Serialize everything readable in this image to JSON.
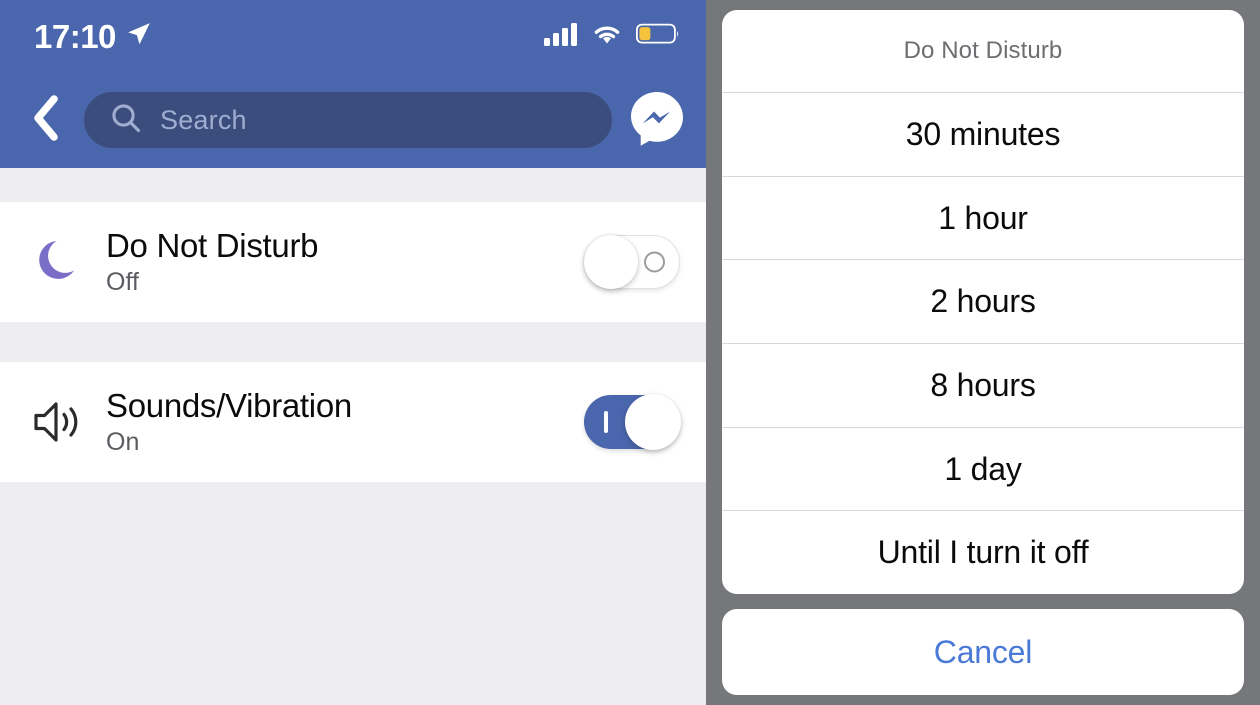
{
  "status_bar": {
    "time": "17:10",
    "location_icon": "location-arrow-icon",
    "cellular_icon": "cellular-signal-icon",
    "wifi_icon": "wifi-icon",
    "battery_icon": "battery-low-icon",
    "battery_level_percent": 30
  },
  "header": {
    "back_icon": "back-chevron-icon",
    "search_placeholder": "Search",
    "search_value": "",
    "search_icon": "search-icon",
    "messenger_icon": "messenger-logo-icon",
    "background_color": "#4a66ad",
    "search_field_color": "#3a4d7d"
  },
  "settings": {
    "rows": [
      {
        "icon": "moon-icon",
        "icon_color": "#7b6ec8",
        "title": "Do Not Disturb",
        "status": "Off",
        "toggle_state": "off"
      },
      {
        "icon": "speaker-waves-icon",
        "icon_color": "#2b2b2e",
        "title": "Sounds/Vibration",
        "status": "On",
        "toggle_state": "on"
      }
    ],
    "page_background_color": "#eeedf1"
  },
  "action_sheet": {
    "title": "Do Not Disturb",
    "options": [
      "30 minutes",
      "1 hour",
      "2 hours",
      "8 hours",
      "1 day",
      "Until I turn it off"
    ],
    "cancel_label": "Cancel",
    "cancel_color": "#4a7ad6",
    "backdrop_color": "#76777a"
  }
}
